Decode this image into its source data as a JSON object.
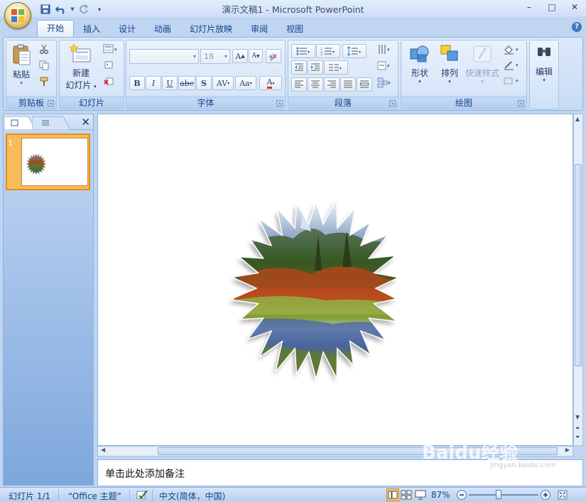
{
  "window": {
    "title": "演示文稿1 - Microsoft PowerPoint",
    "controls": [
      "–",
      "□",
      "✕"
    ]
  },
  "ribbon": {
    "tabs": [
      {
        "label": "开始",
        "active": true
      },
      {
        "label": "插入"
      },
      {
        "label": "设计"
      },
      {
        "label": "动画"
      },
      {
        "label": "幻灯片放映"
      },
      {
        "label": "审阅"
      },
      {
        "label": "视图"
      }
    ],
    "groups": {
      "clipboard": {
        "label": "剪贴板",
        "paste": "粘贴"
      },
      "slides": {
        "label": "幻灯片",
        "new_slide_line1": "新建",
        "new_slide_line2": "幻灯片"
      },
      "font": {
        "label": "字体",
        "font_size": "18"
      },
      "paragraph": {
        "label": "段落"
      },
      "drawing": {
        "label": "绘图",
        "shapes": "形状",
        "arrange": "排列",
        "quick_styles": "快速样式"
      },
      "editing": {
        "label": "编辑"
      }
    }
  },
  "slides_pane": {
    "slide_number": "1"
  },
  "notes": {
    "placeholder": "单击此处添加备注"
  },
  "watermark": {
    "text": "Baidu经验",
    "sub": "jingyan.baidu.com"
  },
  "statusbar": {
    "slide_info": "幻灯片 1/1",
    "theme": "“Office 主题”",
    "language": "中文(简体，中国)",
    "zoom": "87%"
  },
  "colors": {
    "accent": "#15428b",
    "ribbon_bg": "#d1e1f6",
    "selection": "#f7bb5b"
  }
}
